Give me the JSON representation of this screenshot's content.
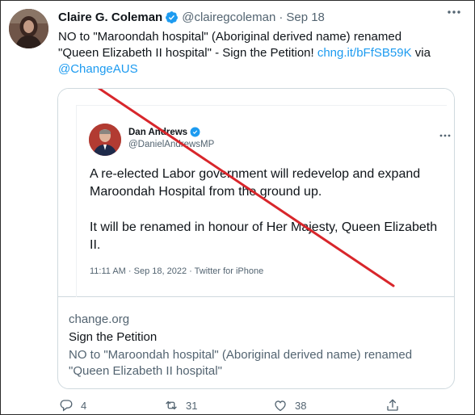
{
  "tweet": {
    "author_name": "Claire G. Coleman",
    "author_handle": "@clairegcoleman",
    "separator": "·",
    "date": "Sep 18",
    "text_before_link": "NO to \"Maroondah hospital\" (Aboriginal derived name) renamed \"Queen Elizabeth II hospital\" - Sign the Petition! ",
    "link_text": "chng.it/bFfSB59K",
    "text_after_link": " via ",
    "mention": "@ChangeAUS"
  },
  "card": {
    "screenshot": {
      "author_name": "Dan Andrews",
      "author_handle": "@DanielAndrewsMP",
      "paragraph_1": "A re-elected Labor government will redevelop and expand Maroondah Hospital from the ground up.",
      "paragraph_2": "It will be renamed in honour of Her Majesty, Queen Elizabeth II.",
      "meta": "11:11 AM · Sep 18, 2022 · Twitter for iPhone",
      "strike_color": "#d8262b"
    },
    "domain": "change.org",
    "title": "Sign the Petition",
    "description": "NO to \"Maroondah hospital\" (Aboriginal derived name) renamed \"Queen Elizabeth II hospital\""
  },
  "actions": {
    "replies": "4",
    "retweets": "31",
    "likes": "38",
    "icons": [
      "reply-icon",
      "retweet-icon",
      "like-icon",
      "share-icon"
    ]
  },
  "colors": {
    "accent": "#1d9bf0",
    "muted": "#536471",
    "text": "#0f1419",
    "border": "#cfd9de"
  }
}
